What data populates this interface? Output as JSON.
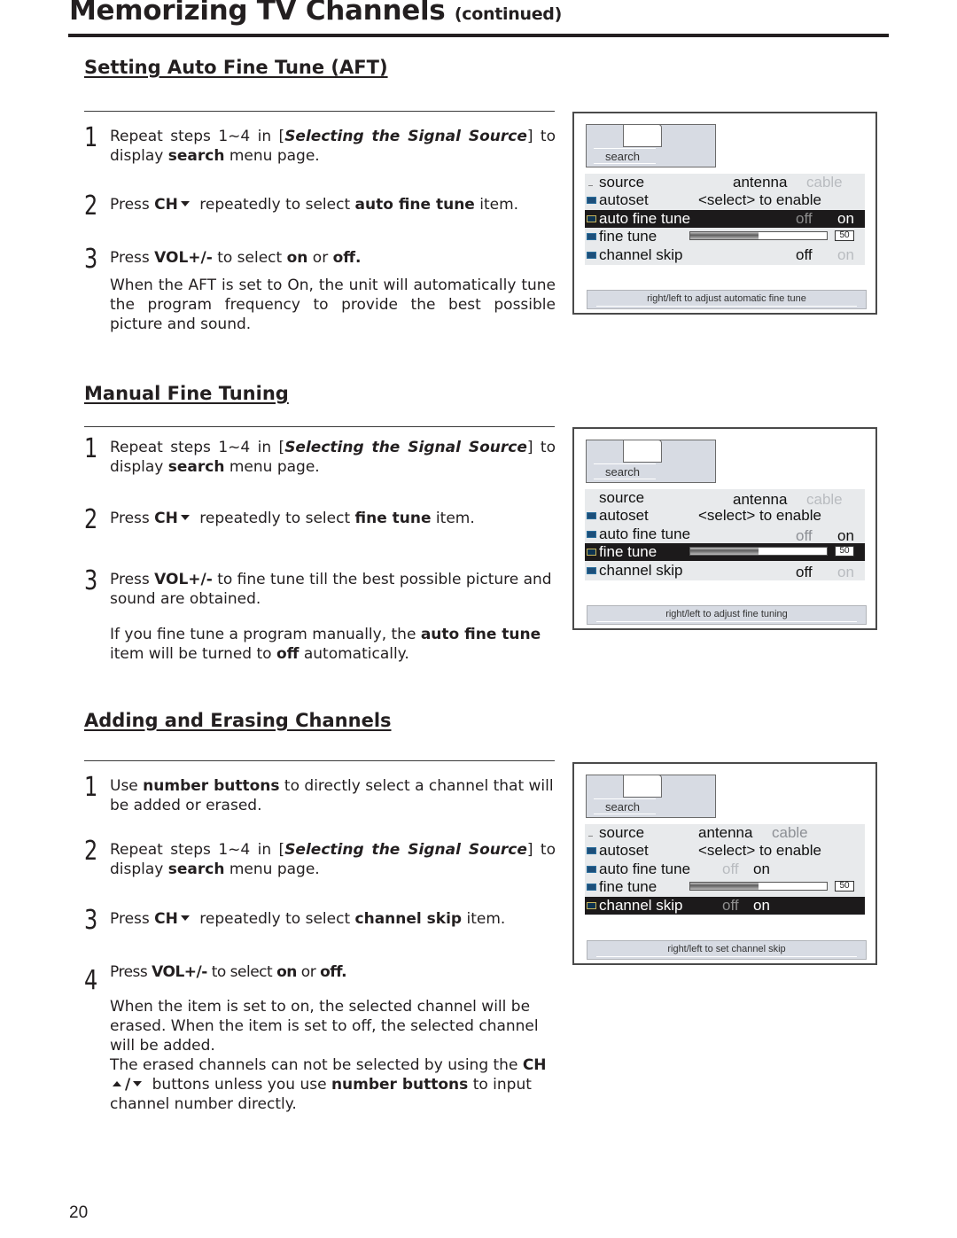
{
  "page": {
    "title": "Memorizing TV Channels",
    "title_suffix": "(continued)",
    "page_number": "20"
  },
  "sections": [
    {
      "heading": "Setting Auto Fine Tune (AFT)",
      "steps": [
        {
          "num": "1",
          "parts": {
            "a": "Repeat steps 1~4 in [",
            "b": "Selecting the Signal Source",
            "c": "] to display ",
            "d": "search",
            "e": " menu page."
          }
        },
        {
          "num": "2",
          "parts": {
            "a": "Press ",
            "b": "CH",
            "c": " repeatedly to select ",
            "d": "auto fine tune",
            "e": " item."
          }
        },
        {
          "num": "3",
          "parts": {
            "a": "Press ",
            "b": "VOL+/-",
            "c": " to select ",
            "d": "on",
            "e": " or ",
            "f": "off."
          }
        }
      ],
      "note": "When the AFT is set to On, the unit will automatically tune the program frequency to provide the best possible picture and sound.",
      "osd": {
        "tab_label": "search",
        "rows": [
          {
            "label": "source",
            "values": [
              "antenna",
              "cable"
            ]
          },
          {
            "label": "autoset",
            "values": [
              "<select> to enable"
            ]
          },
          {
            "label": "auto fine tune",
            "values": [
              "off",
              "on"
            ]
          },
          {
            "label": "fine tune",
            "slider_value": "50",
            "slider_fraction": 0.5
          },
          {
            "label": "channel skip",
            "values": [
              "off",
              "on"
            ]
          }
        ],
        "selected_row": "auto fine tune",
        "hint": "right/left to adjust automatic fine tune"
      }
    },
    {
      "heading": "Manual Fine Tuning",
      "steps": [
        {
          "num": "1",
          "parts": {
            "a": "Repeat steps 1~4 in [",
            "b": "Selecting the Signal Source",
            "c": "] to display ",
            "d": "search",
            "e": " menu page."
          }
        },
        {
          "num": "2",
          "parts": {
            "a": "Press ",
            "b": "CH",
            "c": " repeatedly to select ",
            "d": "fine tune",
            "e": " item."
          }
        },
        {
          "num": "3",
          "parts": {
            "a": "Press ",
            "b": "VOL+/-",
            "c": " to fine tune till the best possible picture and sound are obtained."
          }
        }
      ],
      "note": {
        "a": "If you fine tune a program manually, the ",
        "b": "auto fine tune",
        "c": " item will be turned to ",
        "d": "off",
        "e": " automatically."
      },
      "osd": {
        "tab_label": "search",
        "rows": [
          {
            "label": "source",
            "values": [
              "antenna",
              "cable"
            ]
          },
          {
            "label": "autoset",
            "values": [
              "<select> to enable"
            ]
          },
          {
            "label": "auto fine tune",
            "values": [
              "off",
              "on"
            ]
          },
          {
            "label": "fine tune",
            "slider_value": "50",
            "slider_fraction": 0.5
          },
          {
            "label": "channel skip",
            "values": [
              "off",
              "on"
            ]
          }
        ],
        "selected_row": "fine tune",
        "hint": "right/left to adjust fine tuning"
      }
    },
    {
      "heading": "Adding and Erasing Channels",
      "steps": [
        {
          "num": "1",
          "parts": {
            "a": "Use ",
            "b": "number buttons",
            "c": " to directly select a channel that will be added or erased."
          }
        },
        {
          "num": "2",
          "parts": {
            "a": "Repeat steps 1~4 in [",
            "b": "Selecting the Signal Source",
            "c": "] to display ",
            "d": "search",
            "e": " menu page."
          }
        },
        {
          "num": "3",
          "parts": {
            "a": "Press ",
            "b": "CH",
            "c": " repeatedly to select ",
            "d": "channel skip",
            "e": " item."
          }
        },
        {
          "num": "4",
          "parts": {
            "a": "Press ",
            "b": "VOL+/-",
            "c": " to select ",
            "d": "on",
            "e": " or ",
            "f": "off."
          }
        }
      ],
      "note1": "When the item is set to on, the selected channel will be erased. When the item is set to off, the selected channel will be added.",
      "note2": {
        "a": "The erased channels can not be selected by using the ",
        "b": "CH",
        "c": "/",
        "d": " buttons unless you use ",
        "e": "number buttons",
        "f": " to input channel number directly."
      },
      "osd": {
        "tab_label": "search",
        "rows": [
          {
            "label": "source",
            "values": [
              "antenna",
              "cable"
            ]
          },
          {
            "label": "autoset",
            "values": [
              "<select> to enable"
            ]
          },
          {
            "label": "auto fine tune",
            "values": [
              "off",
              "on"
            ]
          },
          {
            "label": "fine tune",
            "slider_value": "50",
            "slider_fraction": 0.5
          },
          {
            "label": "channel skip",
            "values": [
              "off",
              "on"
            ]
          }
        ],
        "selected_row": "channel skip",
        "hint": "right/left to set channel skip"
      }
    }
  ],
  "icons": {
    "ch_down": "triangle-down",
    "ch_up": "triangle-up",
    "menu_row_icon": "small-screen-icon"
  }
}
